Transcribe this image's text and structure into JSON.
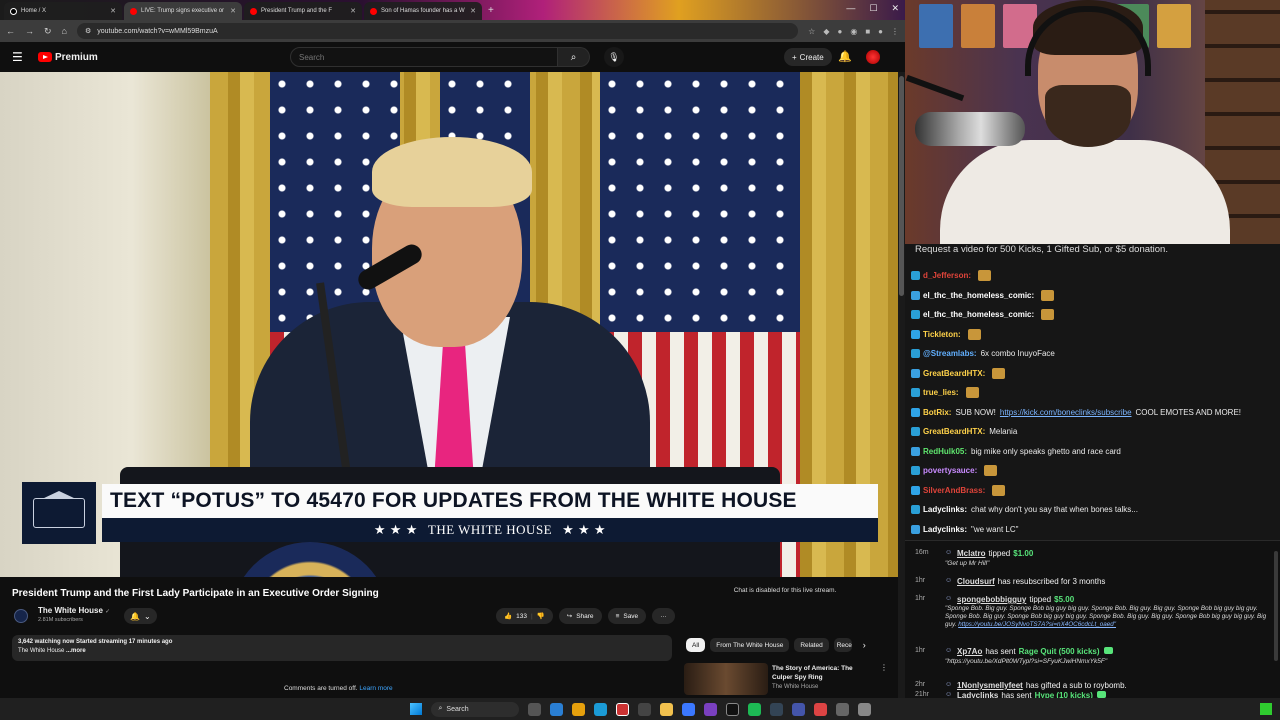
{
  "browser": {
    "tabs": [
      {
        "title": "Home / X",
        "active": false
      },
      {
        "title": "LIVE: Trump signs executive or",
        "active": true
      },
      {
        "title": "President Trump and the F",
        "active": false
      },
      {
        "title": "Son of Hamas founder has a W",
        "active": false
      }
    ],
    "new_tab": "+",
    "url": "youtube.com/watch?v=wMMl59BmzuA",
    "window_controls": [
      "—",
      "☐",
      "✕"
    ]
  },
  "youtube": {
    "logo_text": "Premium",
    "search_placeholder": "Search",
    "create_label": "Create",
    "video": {
      "banner_main": "TEXT “POTUS” TO 45470 FOR UPDATES FROM THE WHITE HOUSE",
      "banner_sub": "THE WHITE HOUSE",
      "stars": "★ ★ ★"
    },
    "title": "President Trump and the First Lady Participate in an Executive Order Signing",
    "channel": {
      "name": "The White House",
      "verified": "✓",
      "subscribers": "2.81M subscribers"
    },
    "actions": {
      "likes": "133",
      "share": "Share",
      "save": "Save",
      "more": "···"
    },
    "description": {
      "stats": "3,642 watching now  Started streaming 17 minutes ago",
      "line2": "The White House",
      "more": "...more"
    },
    "comments_off": "Comments are turned off.",
    "learn_more": "Learn more",
    "chat_disabled": "Chat is disabled for this live stream.",
    "chips": [
      "All",
      "From The White House",
      "Related",
      "Rece"
    ],
    "recommendation": {
      "title": "The Story of America: The Culper Spy Ring",
      "channel": "The White House",
      "more": "⋮"
    }
  },
  "stream_chat": {
    "banner": "Request a video for 500 Kicks, 1 Gifted Sub, or $5 donation.",
    "messages": [
      {
        "user": "d_Jefferson:",
        "color": "#e0443a",
        "text": "",
        "link": "",
        "text2": ""
      },
      {
        "user": "el_thc_the_homeless_comic:",
        "color": "#ffffff",
        "text": "",
        "link": "",
        "text2": ""
      },
      {
        "user": "el_thc_the_homeless_comic:",
        "color": "#ffffff",
        "text": "",
        "link": "",
        "text2": ""
      },
      {
        "user": "Tickleton:",
        "color": "#ffd24a",
        "text": "",
        "link": "",
        "text2": ""
      },
      {
        "user": "@Streamlabs:",
        "color": "#62b0ff",
        "text": "6x  combo InuyoFace",
        "link": "",
        "text2": ""
      },
      {
        "user": "GreatBeardHTX:",
        "color": "#ffd24a",
        "text": "",
        "link": "",
        "text2": ""
      },
      {
        "user": "true_lies:",
        "color": "#ffd24a",
        "text": "",
        "link": "",
        "text2": ""
      },
      {
        "user": "BotRix:",
        "color": "#ffd24a",
        "text": "SUB NOW!",
        "link": "https://kick.com/boneclinks/subscribe",
        "text2": "COOL EMOTES AND MORE!"
      },
      {
        "user": "GreatBeardHTX:",
        "color": "#ffd24a",
        "text": "Melania",
        "link": "",
        "text2": ""
      },
      {
        "user": "RedHulk05:",
        "color": "#5fe66e",
        "text": "big mike only speaks ghetto and race card",
        "link": "",
        "text2": ""
      },
      {
        "user": "povertysauce:",
        "color": "#c98bff",
        "text": "",
        "link": "",
        "text2": ""
      },
      {
        "user": "SilverAndBrass:",
        "color": "#e0443a",
        "text": "",
        "link": "",
        "text2": ""
      },
      {
        "user": "Ladyclinks:",
        "color": "#ffffff",
        "text": "chat why don't you say that when bones talks...",
        "link": "",
        "text2": ""
      },
      {
        "user": "Ladyclinks:",
        "color": "#ffffff",
        "text": "\"we want LC\"",
        "link": "",
        "text2": ""
      }
    ]
  },
  "events": [
    {
      "time": "16m",
      "user": "Mclatro",
      "action": "tipped",
      "amount": "$1.00",
      "note": "\"Get up Mr Hill\""
    },
    {
      "time": "1hr",
      "user": "Cloudsurf",
      "action": "has resubscribed for 3 months",
      "amount": "",
      "note": ""
    },
    {
      "time": "1hr",
      "user": "spongebobbigguy",
      "action": "tipped",
      "amount": "$5.00",
      "note": "\"Sponge Bob. Big guy. Sponge Bob big guy big guy. Sponge Bob. Big guy. Big guy. Sponge Bob big guy big guy. Sponge Bob. Big guy. Sponge Bob big guy big guy. Sponge Bob. Big guy. Big guy. Sponge Bob big guy big guy. Big guy. ",
      "link": "https://youtu.be/JOSyNvoTS7A?si=nX4OC6cdcLt_oaed\""
    },
    {
      "time": "1hr",
      "user": "Xp7Ao",
      "action": "has sent",
      "amount": "Rage Quit (500 kicks)",
      "note": "\"https://youtu.be/XdPlt0WTypl?si=SFyuKJwiHNmxYk5F\""
    },
    {
      "time": "2hr",
      "user": "1Nonlysmellyfeet",
      "action": "has gifted a sub to roybomb.",
      "amount": "",
      "note": ""
    },
    {
      "time": "21hr",
      "user": "Ladyclinks",
      "action": "has sent",
      "amount": "Hype (10 kicks)",
      "note": ""
    }
  ],
  "taskbar": {
    "search": "Search"
  }
}
